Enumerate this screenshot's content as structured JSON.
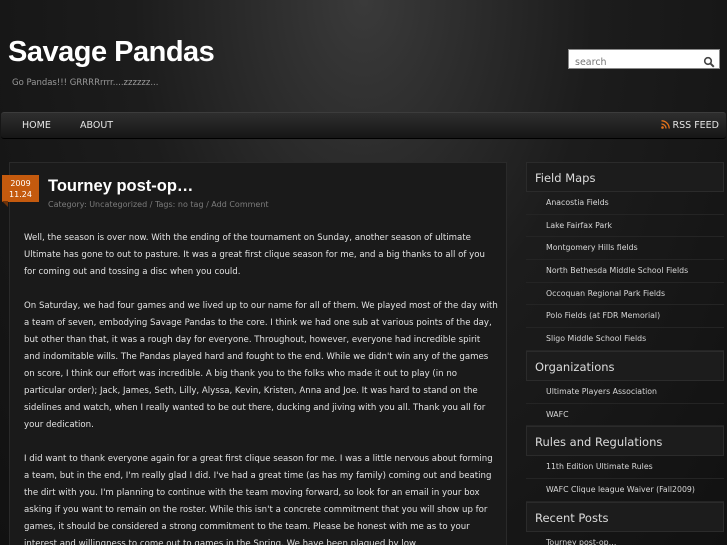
{
  "header": {
    "site_title": "Savage Pandas",
    "tagline": "Go Pandas!!! GRRRRrrrr....zzzzzz...",
    "search_placeholder": "search"
  },
  "nav": {
    "items": [
      {
        "label": "HOME"
      },
      {
        "label": "ABOUT"
      }
    ],
    "rss_label": "RSS FEED"
  },
  "post": {
    "date_year": "2009",
    "date_day": "11.24",
    "title": "Tourney post-op…",
    "meta": "Category: Uncategorized / Tags: no tag / Add Comment",
    "paragraphs": [
      "Well, the season is over now.  With the ending of the tournament on Sunday, another season of ultimate Ultimate has gone to out to pasture.  It was a great first clique season for me, and a big thanks to all of you for coming out and tossing a disc when you could.",
      "On Saturday, we had four games and we lived up to our name for all of them.  We played most of the day with a team of seven, embodying Savage Pandas to the core.  I think we had one sub at various points of the day, but other than that, it was a rough day for everyone.  Throughout, however, everyone had incredible spirit and indomitable wills.  The Pandas played hard and fought to the end.  While we didn't win any of the games on score, I think our effort was incredible.  A big thank you to the folks who made it out to play (in no particular order); Jack, James, Seth, Lilly, Alyssa, Kevin, Kristen, Anna and Joe.  It was hard to stand on the sidelines and watch, when I really wanted to be out there, ducking and jiving with you all.  Thank you all for your dedication.",
      "I did want to thank everyone again for a great first clique season for me.  I was a little nervous about forming a team, but in the end, I'm really glad I did.  I've had a great time (as has my family) coming out and beating the dirt with you.  I'm planning to continue with the team moving forward, so look for an email in your box asking if you want to remain on the roster.  While this isn't a concrete commitment that you will show up for games, it should be considered a strong commitment to the team.  Please be honest with me as to your interest and willingness to come out to games in the Spring.  We have been plagued by low"
    ]
  },
  "sidebar": {
    "widgets": [
      {
        "title": "Field Maps",
        "items": [
          "Anacostia Fields",
          "Lake Fairfax Park",
          "Montgomery Hills fields",
          "North Bethesda Middle School Fields",
          "Occoquan Regional Park Fields",
          "Polo Fields (at FDR Memorial)",
          "Sligo Middle School Fields"
        ]
      },
      {
        "title": "Organizations",
        "items": [
          "Ultimate Players Association",
          "WAFC"
        ]
      },
      {
        "title": "Rules and Regulations",
        "items": [
          "11th Edition Ultimate Rules",
          "WAFC Clique league Waiver (Fall2009)"
        ]
      },
      {
        "title": "Recent Posts",
        "items": [
          "Tourney post-op…"
        ]
      }
    ]
  },
  "colors": {
    "accent": "#c45a0e",
    "rss": "#e8731a"
  }
}
